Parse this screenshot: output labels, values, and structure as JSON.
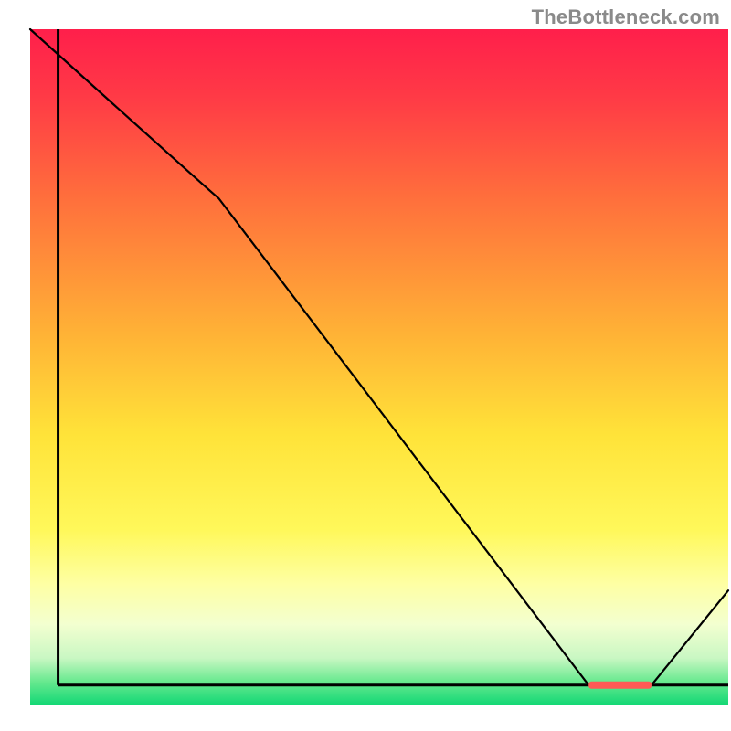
{
  "watermark": "TheBottleneck.com",
  "chart_data": {
    "type": "line",
    "title": "",
    "xlabel": "",
    "ylabel": "",
    "xlim": [
      0,
      100
    ],
    "ylim": [
      0,
      100
    ],
    "x": [
      0,
      27,
      80,
      89,
      100
    ],
    "values": [
      100,
      75,
      3,
      3,
      17
    ],
    "marker": {
      "x_start": 80,
      "x_end": 89,
      "y": 3,
      "color": "#ff5a55"
    },
    "axes": {
      "left_x": 4,
      "right_x": 100,
      "bottom_y": 3,
      "top_y": 100,
      "stroke": "#000000",
      "stroke_width": 3
    },
    "gradient_stops": [
      {
        "offset": 0.0,
        "color": "#ff1f4b"
      },
      {
        "offset": 0.1,
        "color": "#ff3a46"
      },
      {
        "offset": 0.25,
        "color": "#ff6f3c"
      },
      {
        "offset": 0.45,
        "color": "#ffb236"
      },
      {
        "offset": 0.6,
        "color": "#ffe339"
      },
      {
        "offset": 0.74,
        "color": "#fff85a"
      },
      {
        "offset": 0.82,
        "color": "#feffa3"
      },
      {
        "offset": 0.88,
        "color": "#f3ffd0"
      },
      {
        "offset": 0.93,
        "color": "#c9f7c3"
      },
      {
        "offset": 0.965,
        "color": "#67e98f"
      },
      {
        "offset": 1.0,
        "color": "#11d774"
      }
    ],
    "curve_stroke": "#000000",
    "curve_width": 2.2
  }
}
